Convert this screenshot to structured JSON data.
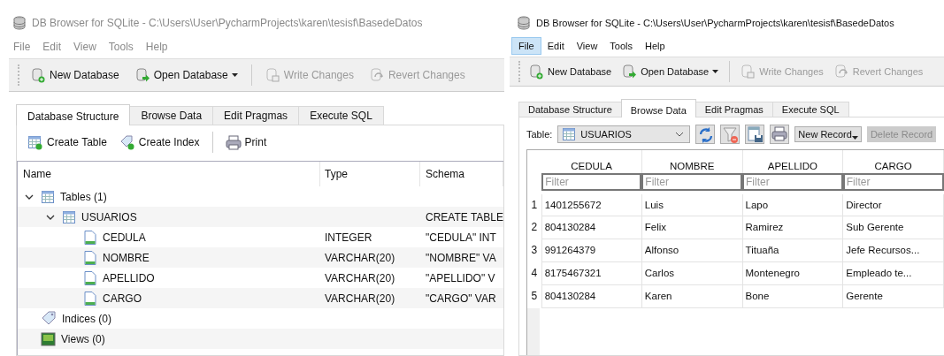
{
  "windows": [
    {
      "kind": "structure",
      "active": false,
      "title": "DB Browser for SQLite - C:\\Users\\User\\PycharmProjects\\karen\\tesisf\\BasedeDatos",
      "menu": [
        {
          "label": "File",
          "selected": false
        },
        {
          "label": "Edit",
          "selected": false
        },
        {
          "label": "View",
          "selected": false
        },
        {
          "label": "Tools",
          "selected": false
        },
        {
          "label": "Help",
          "selected": false
        }
      ],
      "toolbar": [
        {
          "label": "New Database",
          "disabled": false,
          "dropdown": false
        },
        {
          "label": "Open Database",
          "disabled": false,
          "dropdown": true
        },
        {
          "label": "Write Changes",
          "disabled": true,
          "dropdown": false
        },
        {
          "label": "Revert Changes",
          "disabled": true,
          "dropdown": false
        }
      ],
      "tabs": [
        {
          "label": "Database Structure",
          "selected": true
        },
        {
          "label": "Browse Data",
          "selected": false
        },
        {
          "label": "Edit Pragmas",
          "selected": false
        },
        {
          "label": "Execute SQL",
          "selected": false
        }
      ],
      "actions": [
        "Create Table",
        "Create Index",
        "Print"
      ],
      "columns": [
        "Name",
        "Type",
        "Schema"
      ],
      "tree": [
        {
          "kind": "table-group",
          "name": "Tables (1)",
          "expanded": true,
          "children": [
            {
              "kind": "table",
              "name": "USUARIOS",
              "schema": "CREATE TABLE",
              "expanded": true,
              "children": [
                {
                  "kind": "field",
                  "name": "CEDULA",
                  "type": "INTEGER",
                  "schema": "\"CEDULA\" INT"
                },
                {
                  "kind": "field",
                  "name": "NOMBRE",
                  "type": "VARCHAR(20)",
                  "schema": "\"NOMBRE\" VA"
                },
                {
                  "kind": "field",
                  "name": "APELLIDO",
                  "type": "VARCHAR(20)",
                  "schema": "\"APELLIDO\" V"
                },
                {
                  "kind": "field",
                  "name": "CARGO",
                  "type": "VARCHAR(20)",
                  "schema": "\"CARGO\" VAR"
                }
              ]
            }
          ]
        },
        {
          "kind": "index-group",
          "name": "Indices (0)"
        },
        {
          "kind": "view-group",
          "name": "Views (0)"
        }
      ]
    },
    {
      "kind": "browse",
      "active": true,
      "title": "DB Browser for SQLite - C:\\Users\\User\\PycharmProjects\\karen\\tesisf\\BasedeDatos",
      "menu": [
        {
          "label": "File",
          "selected": true
        },
        {
          "label": "Edit",
          "selected": false
        },
        {
          "label": "View",
          "selected": false
        },
        {
          "label": "Tools",
          "selected": false
        },
        {
          "label": "Help",
          "selected": false
        }
      ],
      "toolbar": [
        {
          "label": "New Database",
          "disabled": false,
          "dropdown": false
        },
        {
          "label": "Open Database",
          "disabled": false,
          "dropdown": true
        },
        {
          "label": "Write Changes",
          "disabled": true,
          "dropdown": false
        },
        {
          "label": "Revert Changes",
          "disabled": true,
          "dropdown": false
        }
      ],
      "tabs": [
        {
          "label": "Database Structure",
          "selected": false
        },
        {
          "label": "Browse Data",
          "selected": true
        },
        {
          "label": "Edit Pragmas",
          "selected": false
        },
        {
          "label": "Execute SQL",
          "selected": false
        }
      ],
      "table_label": "Table:",
      "table_value": "USUARIOS",
      "record_buttons": [
        {
          "label": "New Record",
          "disabled": false,
          "dropdown": true
        },
        {
          "label": "Delete Record",
          "disabled": true,
          "dropdown": false
        }
      ],
      "columns": [
        "CEDULA",
        "NOMBRE",
        "APELLIDO",
        "CARGO"
      ],
      "filters": [
        {
          "placeholder": "Filter"
        },
        {
          "placeholder": "Filter"
        },
        {
          "placeholder": "Filter"
        },
        {
          "placeholder": "Filter"
        }
      ],
      "rows": [
        {
          "number": "1",
          "cells": [
            "1401255672",
            "Luis",
            "Lapo",
            "Director"
          ]
        },
        {
          "number": "2",
          "cells": [
            "804130284",
            "Felix",
            "Ramirez",
            "Sub Gerente"
          ]
        },
        {
          "number": "3",
          "cells": [
            "991264379",
            "Alfonso",
            "Tituaña",
            "Jefe Recursos..."
          ]
        },
        {
          "number": "4",
          "cells": [
            "8175467321",
            "Carlos",
            "Montenegro",
            "Empleado te..."
          ]
        },
        {
          "number": "5",
          "cells": [
            "804130284",
            "Karen",
            "Bone",
            "Gerente"
          ]
        }
      ]
    }
  ]
}
